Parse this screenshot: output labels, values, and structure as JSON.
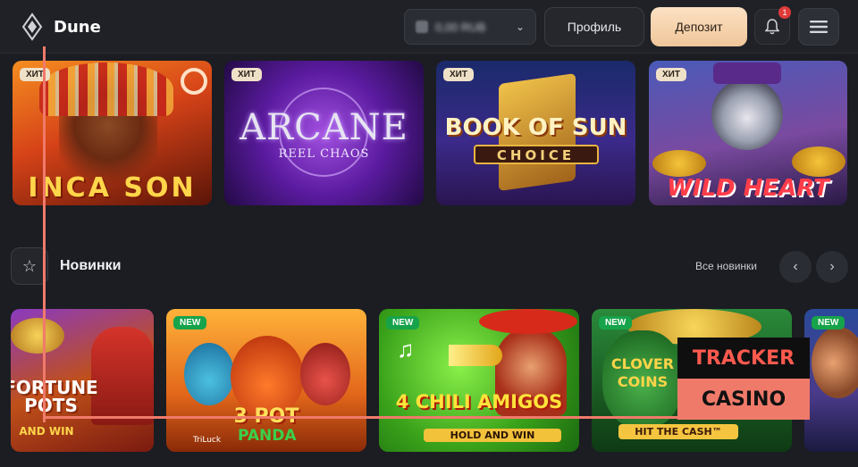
{
  "brand": {
    "name": "Dune"
  },
  "header": {
    "balance_value": "0,00 RUB",
    "profile_label": "Профиль",
    "deposit_label": "Депозит",
    "notification_count": "1"
  },
  "top_games": [
    {
      "badge": "ХИТ",
      "title": "INCA SON"
    },
    {
      "badge": "ХИТ",
      "title": "ARCANE",
      "subtitle": "REEL CHAOS"
    },
    {
      "badge": "ХИТ",
      "title": "BOOK OF SUN",
      "subtitle": "CHOICE"
    },
    {
      "badge": "ХИТ",
      "title": "WILD HEART"
    }
  ],
  "new_section": {
    "title": "Новинки",
    "see_all": "Все новинки",
    "prev_icon": "chevron-left-icon",
    "next_icon": "chevron-right-icon"
  },
  "new_games": [
    {
      "badge": "",
      "title": "FORTUNE POTS",
      "subtitle": "AND WIN"
    },
    {
      "badge": "NEW",
      "title": "3 POT",
      "subtitle": "PANDA",
      "provider": "TriLuck"
    },
    {
      "badge": "NEW",
      "title": "4 CHILI AMIGOS",
      "subtitle": "HOLD AND WIN"
    },
    {
      "badge": "NEW",
      "title": "CLOVER COINS",
      "subtitle": "HIT THE CASH™"
    },
    {
      "badge": "NEW",
      "title": ""
    }
  ],
  "watermark": {
    "line1": "TRACKER",
    "line2": "CASINO"
  },
  "colors": {
    "deposit": "#f0c69a",
    "new_badge": "#16a34a",
    "hit_badge": "#efe0c8",
    "watermark": "#f07a6a"
  }
}
